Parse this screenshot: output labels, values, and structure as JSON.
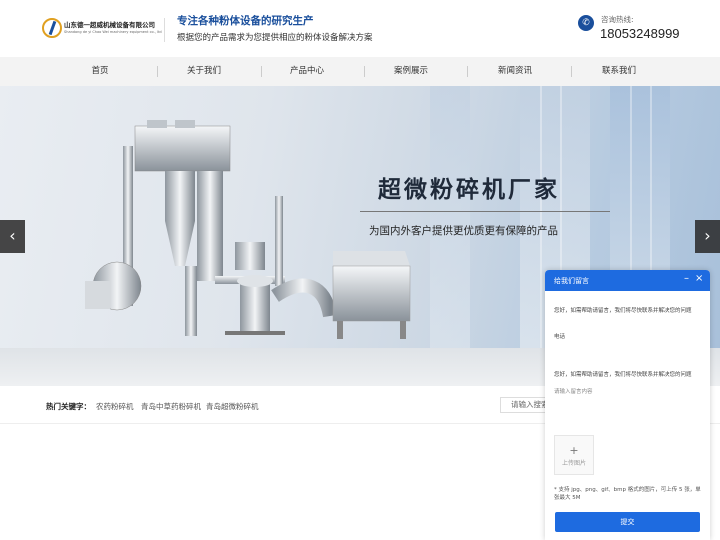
{
  "header": {
    "company_cn": "山东德一超威机械设备有限公司",
    "company_en": "Shandong de yi Chao Wei machinery equipment co., ltd",
    "slogan_main": "专注各种粉体设备的研究生产",
    "slogan_sub": "根据您的产品需求为您提供相应的粉体设备解决方案",
    "hotline_label": "咨询热线:",
    "hotline_number": "18053248999"
  },
  "nav": {
    "items": [
      {
        "label": "首页"
      },
      {
        "label": "关于我们"
      },
      {
        "label": "产品中心"
      },
      {
        "label": "案例展示"
      },
      {
        "label": "新闻资讯"
      },
      {
        "label": "联系我们"
      }
    ]
  },
  "banner": {
    "title": "超微粉碎机厂家",
    "subtitle": "为国内外客户提供更优质更有保障的产品",
    "prev_icon": "chevron-left-icon",
    "next_icon": "chevron-right-icon"
  },
  "keywords": {
    "label": "热门关键字：",
    "items": [
      "农药粉碎机",
      "青岛中草药粉碎机",
      "青岛超微粉碎机"
    ],
    "search_placeholder": "请输入搜索"
  },
  "chat": {
    "title": "给我们留言",
    "minimize": "–",
    "close": "×",
    "greeting": "您好，如需帮助请留言，我们将尽快联系并解决您的问题",
    "phone_label": "电话",
    "greeting2": "您好，如需帮助请留言，我们将尽快联系并解决您的问题",
    "textarea_placeholder": "请输入留言内容",
    "upload_plus": "+",
    "upload_label": "上传图片",
    "upload_note": "* 支持 jpg、png、gif、bmp 格式的图片，可上传 5 张，单张最大 5M",
    "submit_label": "提交"
  },
  "colors": {
    "brand_blue": "#1a4f9c",
    "chat_blue": "#1e6be0"
  }
}
